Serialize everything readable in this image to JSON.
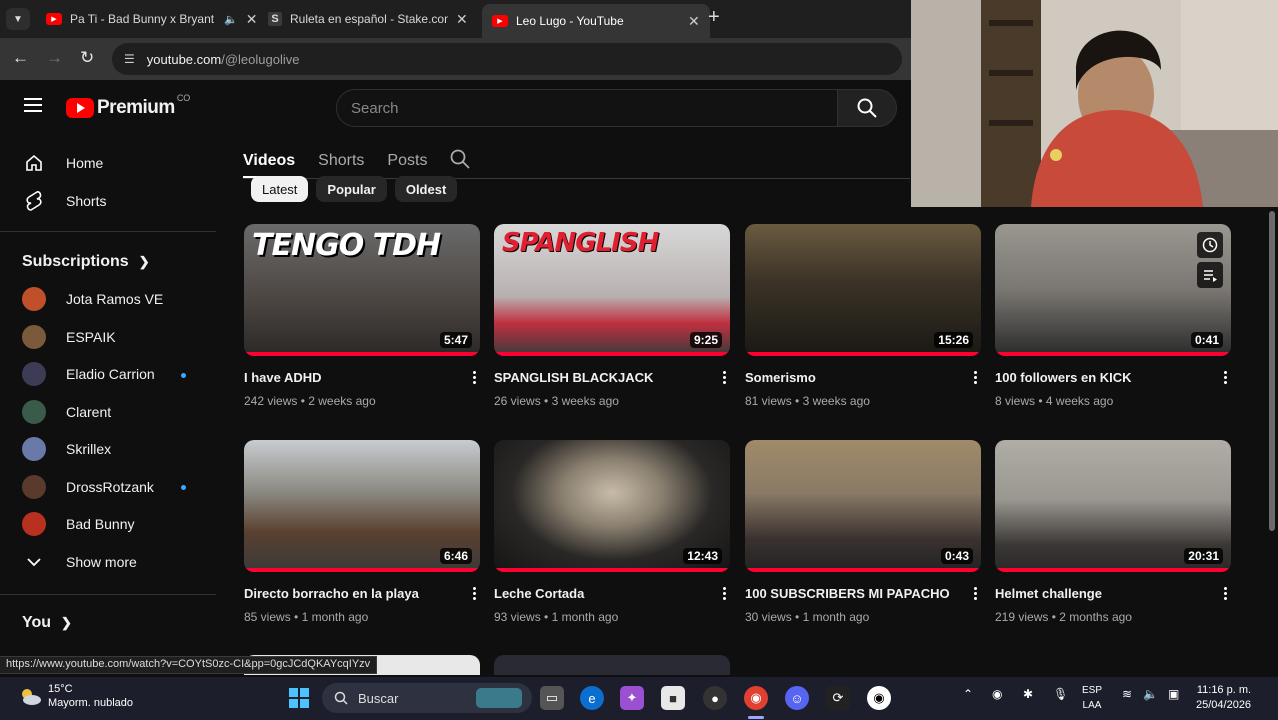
{
  "browser": {
    "tabs": [
      {
        "title": "Pa Ti - Bad Bunny x Bryant M",
        "favicon": "youtube-icon",
        "audio": true
      },
      {
        "title": "Ruleta en español - Stake.com",
        "favicon": "stake-icon"
      },
      {
        "title": "Leo Lugo - YouTube",
        "favicon": "youtube-icon",
        "active": true
      }
    ],
    "url_host": "youtube.com",
    "url_path": "/@leolugolive"
  },
  "header": {
    "logo_text": "Premium",
    "country_code": "CO",
    "search_placeholder": "Search"
  },
  "sidebar": {
    "items": [
      {
        "label": "Home",
        "icon": "home-icon"
      },
      {
        "label": "Shorts",
        "icon": "shorts-icon"
      }
    ],
    "subscriptions_heading": "Subscriptions",
    "subscriptions": [
      {
        "name": "Jota Ramos VE",
        "color": "#c0502a",
        "live": false
      },
      {
        "name": "ESPAIK",
        "color": "#7a5a3a",
        "live": false
      },
      {
        "name": "Eladio Carrion",
        "color": "#3c3c55",
        "live": true
      },
      {
        "name": "Clarent",
        "color": "#3a5a4a",
        "live": false
      },
      {
        "name": "Skrillex",
        "color": "#6a7aa8",
        "live": false
      },
      {
        "name": "DrossRotzank",
        "color": "#5a3a2a",
        "live": true
      },
      {
        "name": "Bad Bunny",
        "color": "#b83020",
        "live": false
      }
    ],
    "show_more": "Show more",
    "you_heading": "You"
  },
  "channel": {
    "tabs": [
      "Videos",
      "Shorts",
      "Posts"
    ],
    "active_tab": "Videos",
    "chips": [
      "Latest",
      "Popular",
      "Oldest"
    ],
    "active_chip": "Latest"
  },
  "videos": [
    {
      "title": "I have ADHD",
      "views": "242 views",
      "age": "2 weeks ago",
      "duration": "5:47",
      "thumb_text": "TENGO TDH",
      "thumb_color": "#8a8a8a"
    },
    {
      "title": "SPANGLISH BLACKJACK",
      "views": "26 views",
      "age": "3 weeks ago",
      "duration": "9:25",
      "thumb_text": "SPANGLISH",
      "thumb_color": "#b8b8b8"
    },
    {
      "title": "Somerismo",
      "views": "81 views",
      "age": "3 weeks ago",
      "duration": "15:26",
      "thumb_text": "",
      "thumb_color": "#3a3226"
    },
    {
      "title": "100 followers en KICK",
      "views": "8 views",
      "age": "4 weeks ago",
      "duration": "0:41",
      "thumb_text": "",
      "thumb_color": "#7a7772"
    },
    {
      "title": "Directo borracho en la playa",
      "views": "85 views",
      "age": "1 month ago",
      "duration": "6:46",
      "thumb_text": "",
      "thumb_color": "#9aa0a0"
    },
    {
      "title": "Leche Cortada",
      "views": "93 views",
      "age": "1 month ago",
      "duration": "12:43",
      "thumb_text": "",
      "thumb_color": "#2a2826"
    },
    {
      "title": "100 SUBSCRIBERS MI PAPACHO",
      "views": "30 views",
      "age": "1 month ago",
      "duration": "0:43",
      "thumb_text": "",
      "thumb_color": "#8a7a66"
    },
    {
      "title": "Helmet challenge",
      "views": "219 views",
      "age": "2 months ago",
      "duration": "20:31",
      "thumb_text": "",
      "thumb_color": "#9a9690"
    }
  ],
  "status_bar_url": "https://www.youtube.com/watch?v=COYtS0zc-CI&pp=0gcJCdQKAYcqIYzv",
  "taskbar": {
    "temperature": "15°C",
    "weather": "Mayorm. nublado",
    "search_label": "Buscar",
    "language": "ESP",
    "language_sub": "LAA",
    "time": "11:16 p. m.",
    "date": "25/04/2026"
  },
  "colors": {
    "accent": "#ff0000",
    "progress": "#ff0033",
    "live_dot": "#3ea6ff",
    "background": "#0f0f0f"
  }
}
